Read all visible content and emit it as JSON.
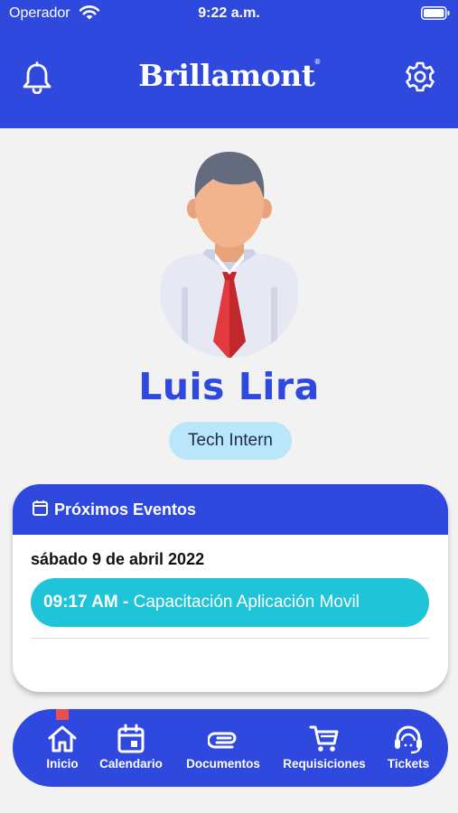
{
  "status_bar": {
    "carrier": "Operador",
    "time": "9:22 a.m."
  },
  "header": {
    "brand": "Brillamont",
    "brand_mark": "®"
  },
  "profile": {
    "name": "Luis Lira",
    "role": "Tech Intern"
  },
  "events": {
    "title": "Próximos Eventos",
    "date": "sábado 9 de abril 2022",
    "items": [
      {
        "time": "09:17 AM -",
        "title": "Capacitación Aplicación Movil"
      }
    ]
  },
  "tabs": [
    {
      "label": "Inicio",
      "icon": "home-icon",
      "active": true
    },
    {
      "label": "Calendario",
      "icon": "calendar-icon",
      "active": false
    },
    {
      "label": "Documentos",
      "icon": "paperclip-icon",
      "active": false
    },
    {
      "label": "Requisiciones",
      "icon": "cart-icon",
      "active": false
    },
    {
      "label": "Tickets",
      "icon": "headset-icon",
      "active": false
    }
  ],
  "colors": {
    "primary": "#2f48de",
    "event": "#1fc4d8",
    "badge": "#b9e6fb",
    "background": "#f2f2f2",
    "active_marker": "#e85050"
  }
}
